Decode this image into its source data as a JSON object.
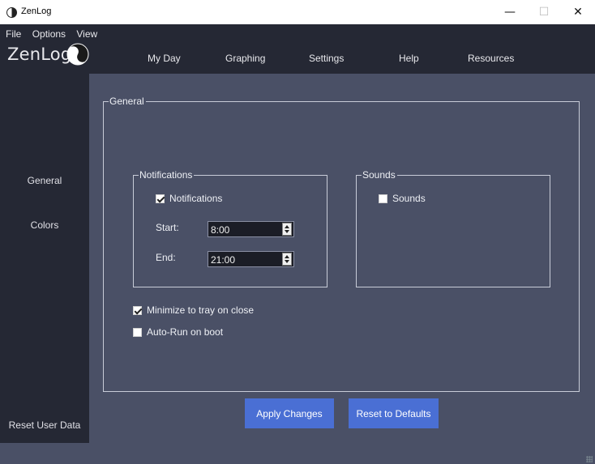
{
  "window": {
    "title": "ZenLog"
  },
  "menu": {
    "file": "File",
    "options": "Options",
    "view": "View"
  },
  "brand": {
    "name": "ZenLog"
  },
  "nav": [
    "My Day",
    "Graphing",
    "Settings",
    "Help",
    "Resources"
  ],
  "sidebar": {
    "general": "General",
    "colors": "Colors",
    "reset": "Reset User Data"
  },
  "settings": {
    "general_title": "General",
    "notifications_group": "Notifications",
    "notifications_check": "Notifications",
    "notifications_checked": true,
    "start_label": "Start:",
    "start_value": "8:00",
    "end_label": "End:",
    "end_value": "21:00",
    "sounds_group": "Sounds",
    "sounds_check": "Sounds",
    "sounds_checked": false,
    "minimize_tray": "Minimize to tray on close",
    "minimize_checked": true,
    "autorun": "Auto-Run on boot",
    "autorun_checked": false
  },
  "buttons": {
    "apply": "Apply Changes",
    "reset": "Reset to Defaults"
  },
  "colors": {
    "header_bg": "#252834",
    "main_bg": "#4a5066",
    "accent": "#4a6fd4"
  }
}
